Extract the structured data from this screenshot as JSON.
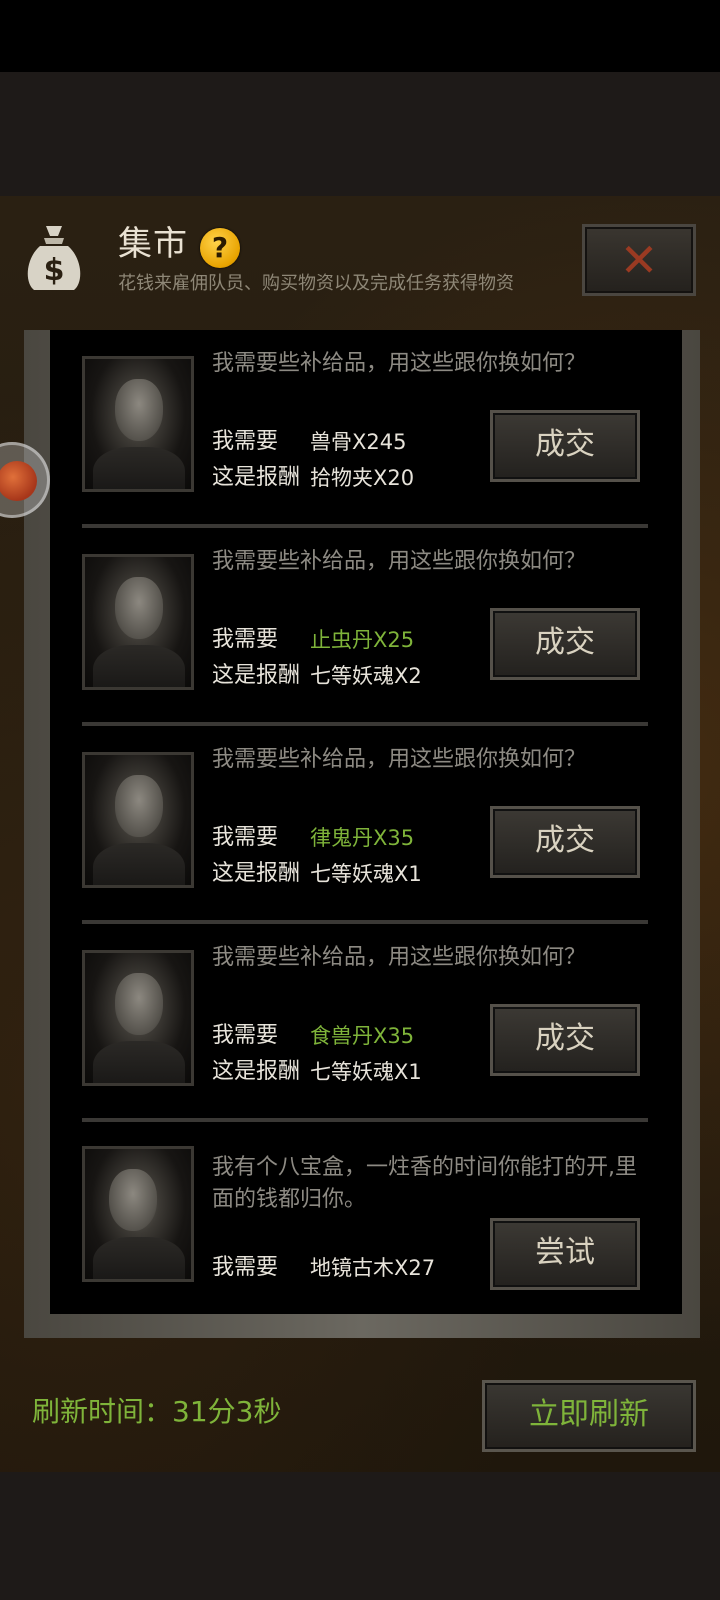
{
  "header": {
    "title": "集市",
    "help_symbol": "?",
    "subtitle": "花钱来雇佣队员、购买物资以及完成任务获得物资",
    "close_symbol": "✕",
    "icon": "money-bag-icon"
  },
  "labels": {
    "need": "我需要",
    "reward": "这是报酬"
  },
  "trades": [
    {
      "description": "我需要些补给品，用这些跟你换如何？",
      "need_item": "兽骨X245",
      "reward_item": "拾物夹X20",
      "button": "成交"
    },
    {
      "description": "我需要些补给品，用这些跟你换如何？",
      "need_item": "止虫丹X25",
      "reward_item": "七等妖魂X2",
      "button": "成交"
    },
    {
      "description": "我需要些补给品，用这些跟你换如何？",
      "need_item": "律鬼丹X35",
      "reward_item": "七等妖魂X1",
      "button": "成交"
    },
    {
      "description": "我需要些补给品，用这些跟你换如何？",
      "need_item": "食兽丹X35",
      "reward_item": "七等妖魂X1",
      "button": "成交"
    },
    {
      "description": "我有个八宝盒，一炷香的时间你能打的开,里面的钱都归你。",
      "need_item": "地镜古木X27",
      "button": "尝试"
    }
  ],
  "footer": {
    "refresh_label": "刷新时间：31分3秒",
    "refresh_button": "立即刷新"
  },
  "colors": {
    "need_item_default": "#e7e3da",
    "need_item_green": "#7fb43a",
    "footer_green": "#7fb43a"
  }
}
